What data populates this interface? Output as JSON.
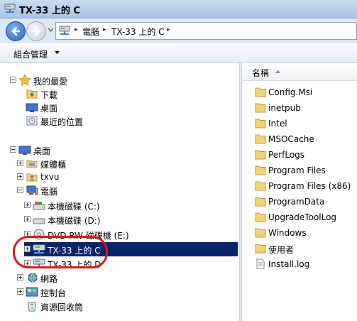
{
  "window": {
    "title": "TX-33 上的 C"
  },
  "address": {
    "crumbs": [
      "電腦",
      "TX-33 上的 C"
    ]
  },
  "toolbar": {
    "organize": "組合管理"
  },
  "nav_tree": {
    "favorites": {
      "label": "我的最愛",
      "items": [
        "下載",
        "桌面",
        "最近的位置"
      ]
    },
    "desktop": {
      "label": "桌面"
    },
    "library": "媒體櫃",
    "user": "txvu",
    "computer": "電腦",
    "drives": [
      "本機磁碟 (C:)",
      "本機磁碟 (D:)",
      "DVD RW 磁碟機 (E:)",
      "TX-33 上的 C",
      "TX-33 上的 D"
    ],
    "network": "網路",
    "control_panel": "控制台",
    "recycle_bin": "資源回收筒"
  },
  "file_list": {
    "column_name": "名稱",
    "items": [
      {
        "name": "Config.Msi",
        "type": "folder"
      },
      {
        "name": "inetpub",
        "type": "folder"
      },
      {
        "name": "Intel",
        "type": "folder"
      },
      {
        "name": "MSOCache",
        "type": "folder"
      },
      {
        "name": "PerfLogs",
        "type": "folder"
      },
      {
        "name": "Program Files",
        "type": "folder"
      },
      {
        "name": "Program Files (x86)",
        "type": "folder"
      },
      {
        "name": "ProgramData",
        "type": "folder"
      },
      {
        "name": "UpgradeToolLog",
        "type": "folder"
      },
      {
        "name": "Windows",
        "type": "folder"
      },
      {
        "name": "使用者",
        "type": "folder"
      },
      {
        "name": "Install.log",
        "type": "file"
      }
    ]
  },
  "colors": {
    "selection": "#0a246a",
    "annotation": "#e4141a"
  }
}
